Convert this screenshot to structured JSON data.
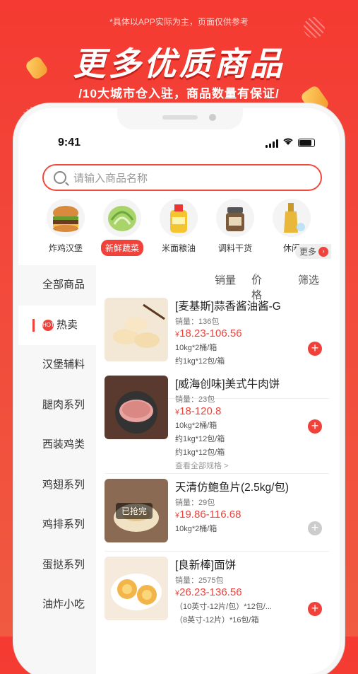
{
  "banner": {
    "notice": "*具体以APP实际为主，页面仅供参考",
    "headline": "更多优质商品",
    "subline": "/10大城市仓入驻，商品数量有保证/"
  },
  "status_bar": {
    "time": "9:41"
  },
  "search": {
    "placeholder": "请输入商品名称"
  },
  "categories": [
    {
      "label": "炸鸡汉堡",
      "icon": "burger-icon"
    },
    {
      "label": "新鲜蔬菜",
      "icon": "lettuce-icon",
      "active": true
    },
    {
      "label": "米面粮油",
      "icon": "oil-bottle-icon"
    },
    {
      "label": "调料干货",
      "icon": "spice-jar-icon"
    },
    {
      "label": "休闲",
      "icon": "beer-icon"
    }
  ],
  "more_label": "更多",
  "sidebar": {
    "items": [
      {
        "label": "全部商品"
      },
      {
        "label": "热卖",
        "hot_badge": "HOT"
      },
      {
        "label": "汉堡辅料"
      },
      {
        "label": "腿肉系列"
      },
      {
        "label": "西装鸡类"
      },
      {
        "label": "鸡翅系列"
      },
      {
        "label": "鸡排系列"
      },
      {
        "label": "蛋挞系列"
      },
      {
        "label": "油炸小吃"
      }
    ]
  },
  "sort_bar": {
    "sales": "销量",
    "price": "价格",
    "filter": "筛选"
  },
  "products": [
    {
      "name": "[麦基斯]蒜香酱油酱-G",
      "sales": "销量：136包",
      "price": "18.23-106.56",
      "specs": [
        "10kg*2桶/箱",
        "约1kg*12包/箱"
      ],
      "view_all": "",
      "soldout": "",
      "available": true
    },
    {
      "name": "[威海创味]美式牛肉饼",
      "sales": "销量：23包",
      "price": "18-120.8",
      "specs": [
        "10kg*2桶/箱",
        "约1kg*12包/箱",
        "约1kg*12包/箱"
      ],
      "view_all": "查看全部规格 >",
      "soldout": "",
      "available": true
    },
    {
      "name": "天清仿鲍鱼片(2.5kg/包)",
      "sales": "销量：29包",
      "price": "19.86-116.68",
      "specs": [
        "10kg*2桶/箱"
      ],
      "view_all": "",
      "soldout": "已抢完",
      "available": false
    },
    {
      "name": "[良新棒]面饼",
      "sales": "销量：2575包",
      "price": "26.23-136.56",
      "specs": [
        "（10英寸-12片/包）*12包/...",
        "（8英寸-12片）*16包/箱"
      ],
      "view_all": "",
      "soldout": "",
      "available": true
    }
  ],
  "currency": "¥"
}
